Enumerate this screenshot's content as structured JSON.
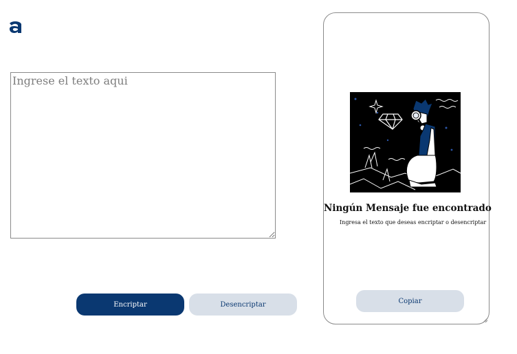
{
  "header": {
    "logo_icon": "alura-a-logo-icon"
  },
  "input": {
    "placeholder": "Ingrese el texto aqui",
    "value": ""
  },
  "actions": {
    "encrypt_label": "Encriptar",
    "decrypt_label": "Desencriptar"
  },
  "output": {
    "illustration_icon": "person-with-magnifier-illustration",
    "title": "Ningún Mensaje fue encontrado",
    "subtitle": "Ingresa el texto que deseas encriptar o desencriptar",
    "copy_label": "Copiar"
  },
  "colors": {
    "primary": "#0a3871",
    "secondary": "#d8dfe8",
    "border": "#8a8a8a"
  }
}
